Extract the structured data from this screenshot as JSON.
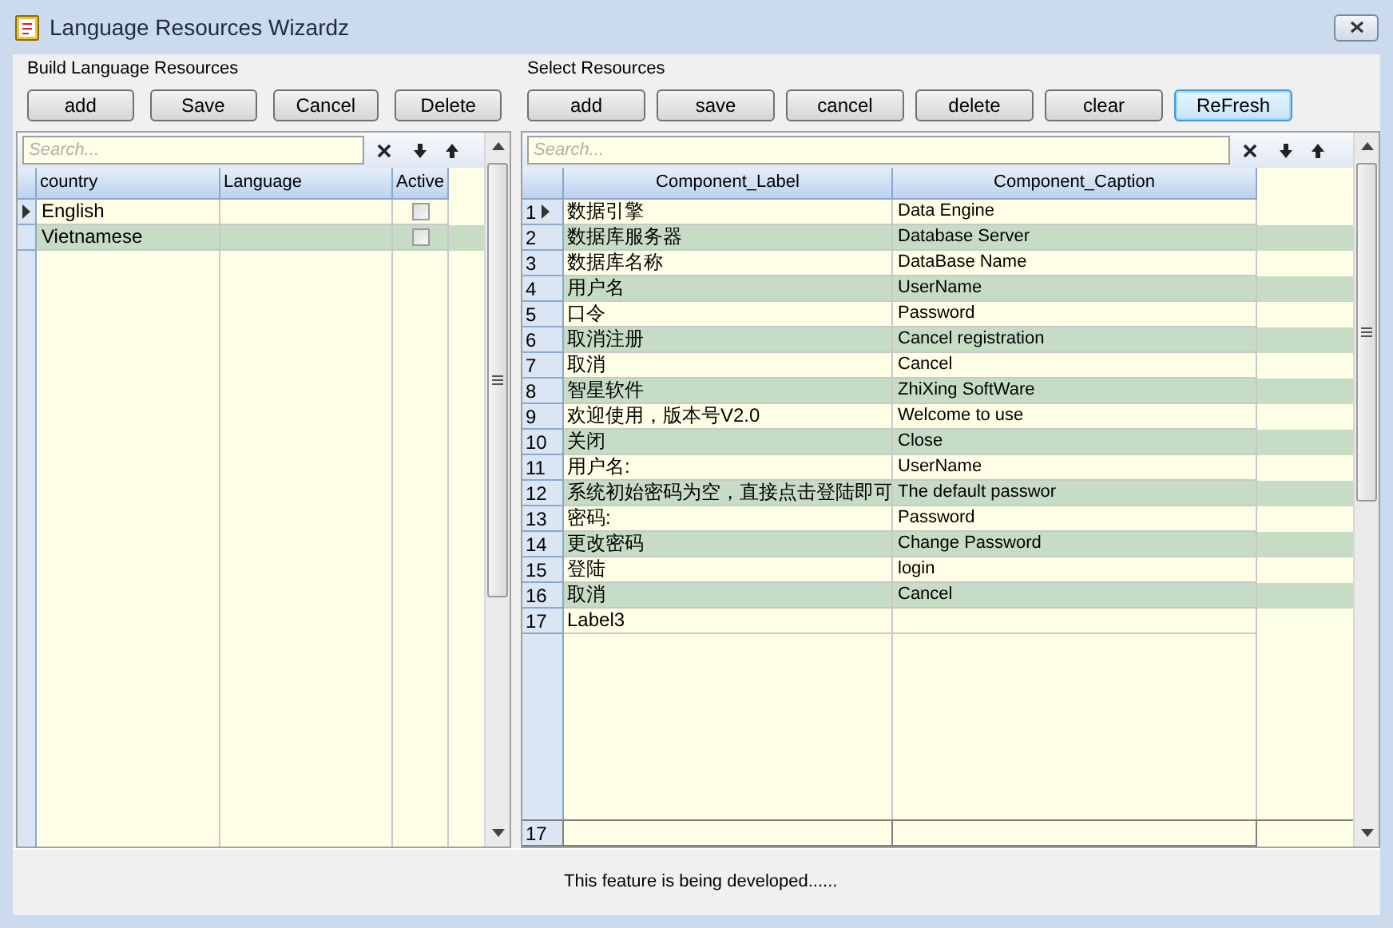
{
  "window": {
    "title": "Language Resources Wizardz"
  },
  "left": {
    "group_title": "Build  Language Resources",
    "buttons": [
      {
        "label": "add",
        "focused": false
      },
      {
        "label": "Save",
        "focused": false
      },
      {
        "label": "Cancel",
        "focused": false
      },
      {
        "label": "Delete",
        "focused": false
      }
    ],
    "search": {
      "placeholder": "Search..."
    },
    "columns": [
      "country",
      "Language",
      "Active"
    ],
    "rows": [
      {
        "country": "English",
        "language": "",
        "active": false,
        "selected": true
      },
      {
        "country": "Vietnamese",
        "language": "",
        "active": false,
        "selected": false
      }
    ]
  },
  "right": {
    "group_title": "Select Resources",
    "buttons": [
      {
        "label": "add",
        "focused": false
      },
      {
        "label": "save",
        "focused": false
      },
      {
        "label": "cancel",
        "focused": false
      },
      {
        "label": "delete",
        "focused": false
      },
      {
        "label": "clear",
        "focused": false
      },
      {
        "label": "ReFresh",
        "focused": true
      }
    ],
    "search": {
      "placeholder": "Search..."
    },
    "columns": [
      "Component_Label",
      "Component_Caption"
    ],
    "rows": [
      {
        "num": "1",
        "label": "数据引擎",
        "caption": "Data Engine",
        "selected": true
      },
      {
        "num": "2",
        "label": "数据库服务器",
        "caption": "Database Server",
        "selected": false
      },
      {
        "num": "3",
        "label": "数据库名称",
        "caption": "DataBase Name",
        "selected": false
      },
      {
        "num": "4",
        "label": "用户名",
        "caption": "UserName",
        "selected": false
      },
      {
        "num": "5",
        "label": "口令",
        "caption": "Password",
        "selected": false
      },
      {
        "num": "6",
        "label": "取消注册",
        "caption": "Cancel registration",
        "selected": false
      },
      {
        "num": "7",
        "label": "取消",
        "caption": "Cancel",
        "selected": false
      },
      {
        "num": "8",
        "label": "智星软件",
        "caption": "ZhiXing SoftWare",
        "selected": false
      },
      {
        "num": "9",
        "label": "欢迎使用，版本号V2.0",
        "caption": "Welcome to use",
        "selected": false
      },
      {
        "num": "10",
        "label": "关闭",
        "caption": "Close",
        "selected": false
      },
      {
        "num": "11",
        "label": "用户名:",
        "caption": "UserName",
        "selected": false
      },
      {
        "num": "12",
        "label": "系统初始密码为空，直接点击登陆即可",
        "caption": "The default passwor",
        "selected": false
      },
      {
        "num": "13",
        "label": "密码:",
        "caption": "Password",
        "selected": false
      },
      {
        "num": "14",
        "label": "更改密码",
        "caption": "Change Password",
        "selected": false
      },
      {
        "num": "15",
        "label": "登陆",
        "caption": "login",
        "selected": false
      },
      {
        "num": "16",
        "label": "取消",
        "caption": "Cancel",
        "selected": false
      },
      {
        "num": "17",
        "label": "Label3",
        "caption": "",
        "selected": false
      }
    ],
    "footer": {
      "count": "17"
    }
  },
  "status_bar": {
    "text": "This feature is being developed......"
  }
}
